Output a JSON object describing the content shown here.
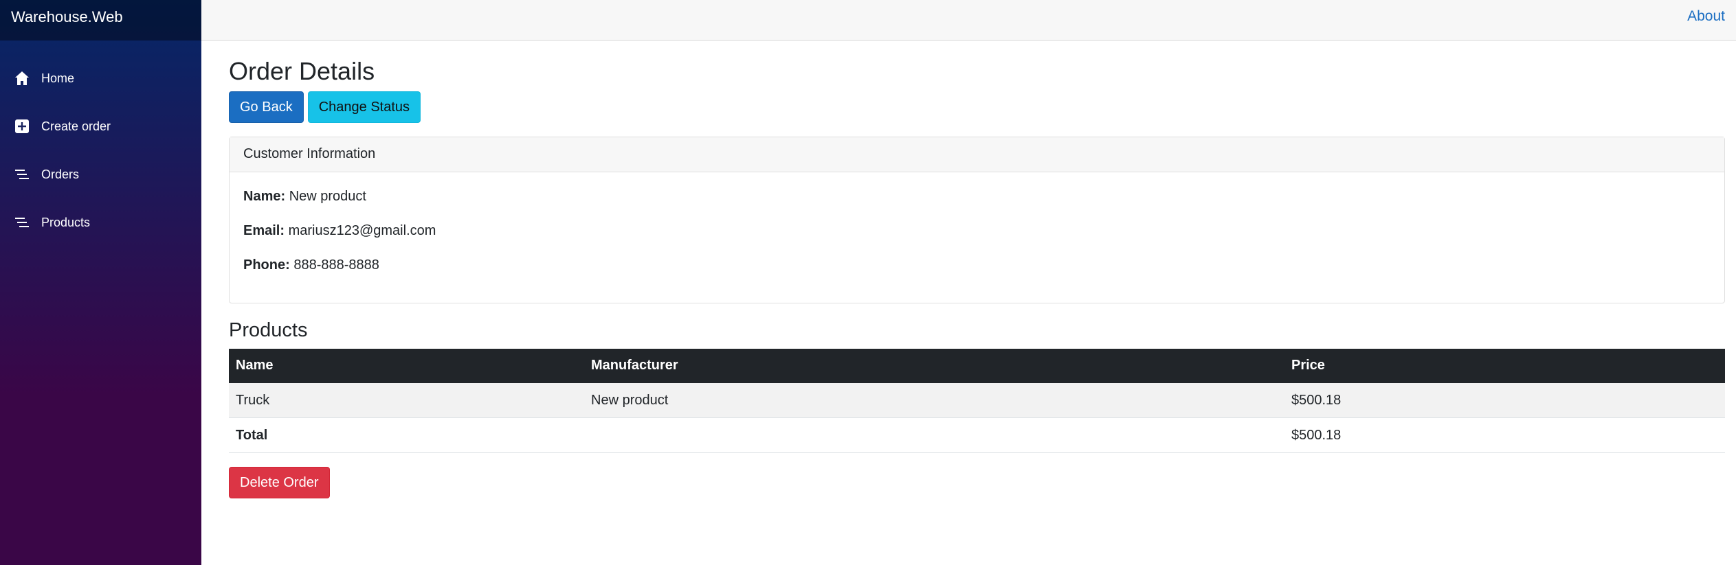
{
  "app": {
    "brand": "Warehouse.Web"
  },
  "sidebar": {
    "items": [
      {
        "label": "Home",
        "icon": "home-icon"
      },
      {
        "label": "Create order",
        "icon": "plus-square-icon"
      },
      {
        "label": "Orders",
        "icon": "list-icon"
      },
      {
        "label": "Products",
        "icon": "list-icon"
      }
    ]
  },
  "topbar": {
    "about_label": "About"
  },
  "page": {
    "title": "Order Details",
    "go_back_label": "Go Back",
    "change_status_label": "Change Status",
    "delete_label": "Delete Order"
  },
  "customer": {
    "header": "Customer Information",
    "name_label": "Name:",
    "name_value": "New product",
    "email_label": "Email:",
    "email_value": "mariusz123@gmail.com",
    "phone_label": "Phone:",
    "phone_value": "888-888-8888"
  },
  "products": {
    "title": "Products",
    "columns": [
      "Name",
      "Manufacturer",
      "Price"
    ],
    "rows": [
      {
        "name": "Truck",
        "manufacturer": "New product",
        "price": "$500.18"
      }
    ],
    "total_label": "Total",
    "total_value": "$500.18"
  },
  "colors": {
    "primary": "#1b6ec2",
    "info": "#17c2e8",
    "danger": "#dc3545",
    "table_header": "#212529",
    "sidebar_top": "#052767",
    "sidebar_bottom": "#3a0647"
  }
}
